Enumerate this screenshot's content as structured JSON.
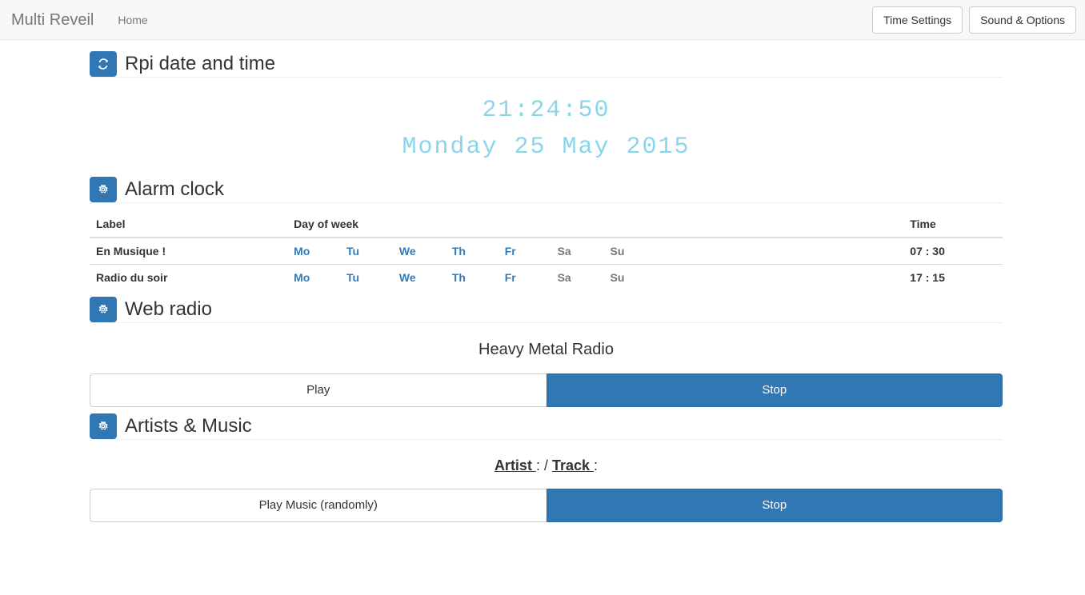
{
  "navbar": {
    "brand": "Multi Reveil",
    "links": [
      {
        "label": "Home"
      }
    ],
    "buttons": [
      {
        "label": "Time Settings"
      },
      {
        "label": "Sound & Options"
      }
    ]
  },
  "sections": {
    "datetime": {
      "icon": "refresh-icon",
      "title": "Rpi date and time",
      "time": "21:24:50",
      "date": "Monday 25 May 2015",
      "color": "#8ad5ea"
    },
    "alarm": {
      "icon": "gear-icon",
      "title": "Alarm clock",
      "headers": {
        "label": "Label",
        "day_of_week": "Day of week",
        "time": "Time"
      },
      "rows": [
        {
          "label": "En Musique !",
          "days": [
            {
              "name": "Mo",
              "active": true
            },
            {
              "name": "Tu",
              "active": true
            },
            {
              "name": "We",
              "active": true
            },
            {
              "name": "Th",
              "active": true
            },
            {
              "name": "Fr",
              "active": true
            },
            {
              "name": "Sa",
              "active": false
            },
            {
              "name": "Su",
              "active": false
            }
          ],
          "time": "07 : 30"
        },
        {
          "label": "Radio du soir",
          "days": [
            {
              "name": "Mo",
              "active": true
            },
            {
              "name": "Tu",
              "active": true
            },
            {
              "name": "We",
              "active": true
            },
            {
              "name": "Th",
              "active": true
            },
            {
              "name": "Fr",
              "active": true
            },
            {
              "name": "Sa",
              "active": false
            },
            {
              "name": "Su",
              "active": false
            }
          ],
          "time": "17 : 15"
        }
      ]
    },
    "webradio": {
      "icon": "gear-icon",
      "title": "Web radio",
      "station": "Heavy Metal Radio",
      "play_label": "Play",
      "stop_label": "Stop"
    },
    "music": {
      "icon": "gear-icon",
      "title": "Artists & Music",
      "artist_label": "Artist ",
      "artist_value": ":",
      "separator": " / ",
      "track_label": "Track ",
      "track_value": ":",
      "play_label": "Play Music (randomly)",
      "stop_label": "Stop"
    }
  },
  "colors": {
    "accent": "#3177b4",
    "link": "#337ab7",
    "clock": "#8ad5ea",
    "muted": "#777777"
  }
}
